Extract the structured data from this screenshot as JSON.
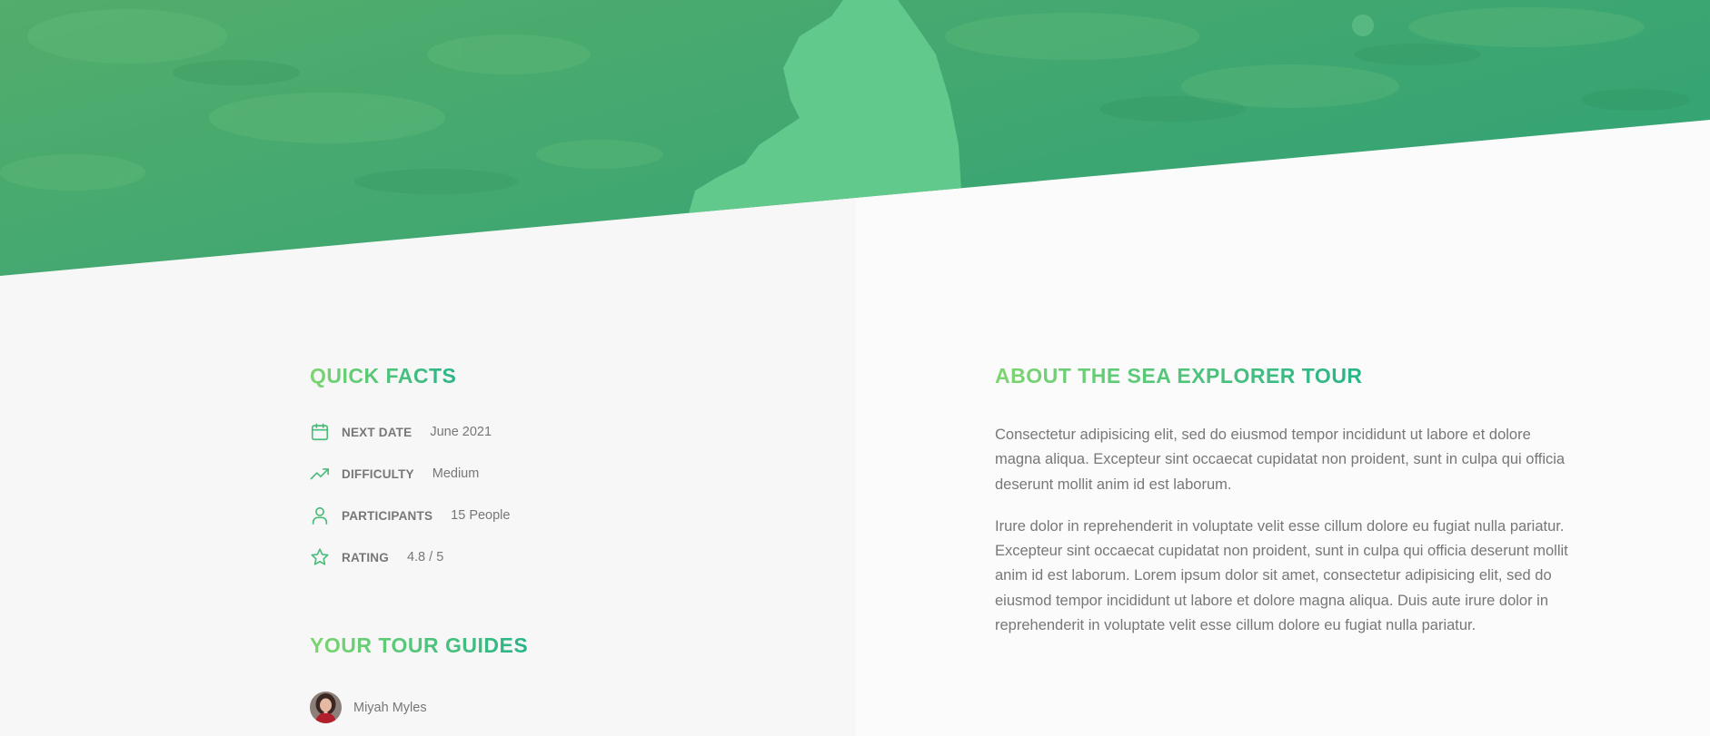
{
  "colors": {
    "accent_light": "#7dd56f",
    "accent_dark": "#28b487",
    "text_muted": "#777777",
    "left_column_bg": "#f7f7f7",
    "right_column_bg": "#fbfbfb"
  },
  "quick_facts": {
    "heading": "QUICK FACTS",
    "items": [
      {
        "icon": "calendar-icon",
        "label": "NEXT DATE",
        "value": "June 2021"
      },
      {
        "icon": "trending-up-icon",
        "label": "DIFFICULTY",
        "value": "Medium"
      },
      {
        "icon": "user-icon",
        "label": "PARTICIPANTS",
        "value": "15 People"
      },
      {
        "icon": "star-icon",
        "label": "RATING",
        "value": "4.8 / 5"
      }
    ]
  },
  "tour_guides": {
    "heading": "YOUR TOUR GUIDES",
    "guides": [
      {
        "name": "Miyah Myles"
      }
    ]
  },
  "about": {
    "heading": "ABOUT THE SEA EXPLORER TOUR",
    "paragraphs": [
      "Consectetur adipisicing elit, sed do eiusmod tempor incididunt ut labore et dolore magna aliqua. Excepteur sint occaecat cupidatat non proident, sunt in culpa qui officia deserunt mollit anim id est laborum.",
      "Irure dolor in reprehenderit in voluptate velit esse cillum dolore eu fugiat nulla pariatur. Excepteur sint occaecat cupidatat non proident, sunt in culpa qui officia deserunt mollit anim id est laborum. Lorem ipsum dolor sit amet, consectetur adipisicing elit, sed do eiusmod tempor incididunt ut labore et dolore magna aliqua. Duis aute irure dolor in reprehenderit in voluptate velit esse cillum dolore eu fugiat nulla pariatur."
    ]
  }
}
